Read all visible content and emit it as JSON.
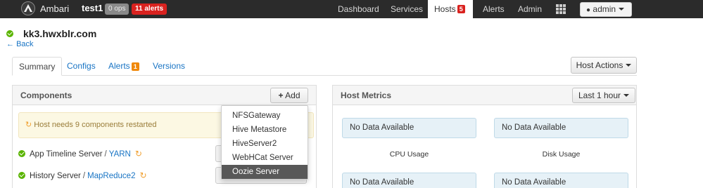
{
  "navbar": {
    "brand": "Ambari",
    "cluster": "test1",
    "ops_badge": "0 ops",
    "alerts_badge": "11 alerts",
    "items": [
      {
        "label": "Dashboard"
      },
      {
        "label": "Services"
      },
      {
        "label": "Hosts",
        "count": "5"
      },
      {
        "label": "Alerts"
      },
      {
        "label": "Admin"
      }
    ],
    "user_label": "admin",
    "colors": {
      "bar": "#2b2b2b",
      "alert_red": "#d9221f"
    }
  },
  "host": {
    "name": "kk3.hwxblr.com",
    "back_label": "Back"
  },
  "tabs": [
    {
      "label": "Summary"
    },
    {
      "label": "Configs"
    },
    {
      "label": "Alerts",
      "count": "1"
    },
    {
      "label": "Versions"
    }
  ],
  "host_actions_label": "Host Actions",
  "components_panel": {
    "title": "Components",
    "add_label": "Add",
    "restart_message": "Host needs 9 components restarted",
    "rows": [
      {
        "name": "App Timeline Server",
        "service": "YARN"
      },
      {
        "name": "History Server",
        "service": "MapReduce2"
      }
    ]
  },
  "add_dropdown": {
    "items": [
      {
        "label": "NFSGateway"
      },
      {
        "label": "Hive Metastore"
      },
      {
        "label": "HiveServer2"
      },
      {
        "label": "WebHCat Server"
      },
      {
        "label": "Oozie Server",
        "highlighted": true
      }
    ]
  },
  "metrics_panel": {
    "title": "Host Metrics",
    "range_label": "Last 1 hour",
    "boxes": [
      {
        "text": "No Data Available",
        "label": "CPU Usage"
      },
      {
        "text": "No Data Available",
        "label": "Disk Usage"
      },
      {
        "text": "No Data Available"
      },
      {
        "text": "No Data Available"
      }
    ]
  }
}
